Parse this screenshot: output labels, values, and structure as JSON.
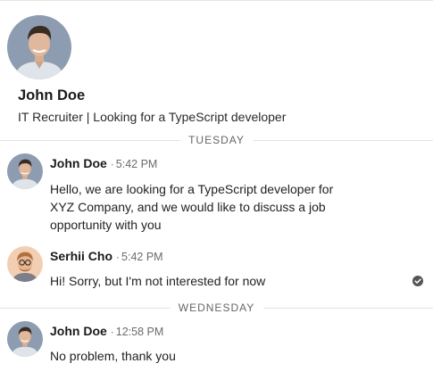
{
  "profile": {
    "name": "John Doe",
    "headline": "IT Recruiter | Looking for a TypeScript developer"
  },
  "days": [
    {
      "label": "TUESDAY"
    },
    {
      "label": "WEDNESDAY"
    }
  ],
  "messages": [
    {
      "sender": "John Doe",
      "separator": "·",
      "time": "5:42 PM",
      "lines": [
        "Hello, we are looking for a TypeScript developer for",
        "XYZ Company, and we would like to discuss a job",
        "opportunity with you"
      ]
    },
    {
      "sender": "Serhii Cho",
      "separator": "·",
      "time": "5:42 PM",
      "lines": [
        "Hi! Sorry, but I'm not interested for now"
      ],
      "read_icon": "check-circle-icon"
    },
    {
      "sender": "John Doe",
      "separator": "·",
      "time": "12:58 PM",
      "lines": [
        "No problem, thank you"
      ]
    }
  ],
  "colors": {
    "avatar_bg_john": "#8a9bb0",
    "avatar_bg_serhii": "#f2c9a8",
    "read_icon": "#555555"
  }
}
